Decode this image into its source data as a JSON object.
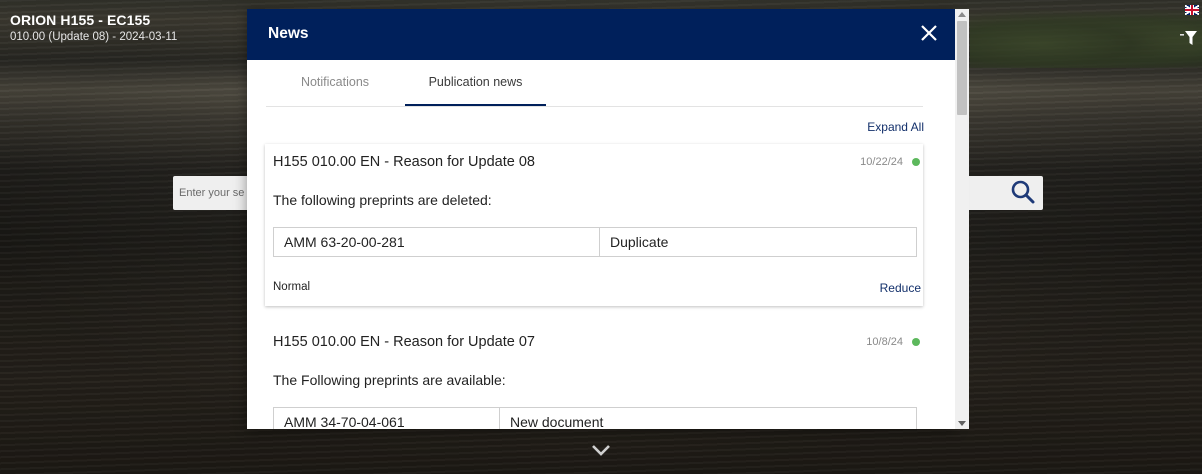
{
  "app": {
    "title": "ORION H155 - EC155",
    "subtitle": "010.00 (Update 08) - 2024-03-11"
  },
  "search": {
    "placeholder": "Enter your se"
  },
  "modal": {
    "title": "News",
    "tabs": [
      {
        "label": "Notifications",
        "active": false
      },
      {
        "label": "Publication news",
        "active": true
      }
    ],
    "expand_all": "Expand All",
    "news": [
      {
        "title": "H155 010.00 EN - Reason for Update 08",
        "date": "10/22/24",
        "status_color": "#5cb85c",
        "text": "The following preprints are deleted:",
        "rows": [
          {
            "ref": "AMM 63-20-00-281",
            "note": "Duplicate"
          }
        ],
        "priority": "Normal",
        "reduce_label": "Reduce"
      },
      {
        "title": "H155 010.00 EN - Reason for Update 07",
        "date": "10/8/24",
        "status_color": "#5cb85c",
        "text": "The Following preprints are available:",
        "rows": [
          {
            "ref": "AMM 34-70-04-061",
            "note": "New document"
          }
        ]
      }
    ]
  },
  "colors": {
    "header_bg": "#00205b",
    "link": "#13306b"
  },
  "icons": {
    "close": "close-icon",
    "search": "search-icon",
    "filter": "filter-icon",
    "flag": "flag-icon",
    "chevron": "chevron-down-icon"
  }
}
